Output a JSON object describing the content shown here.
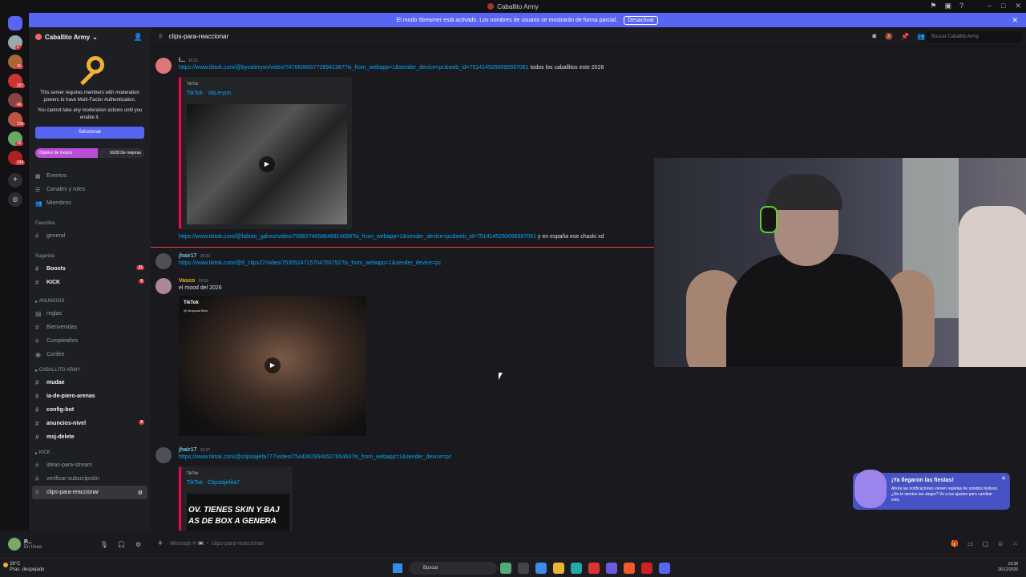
{
  "window": {
    "title": "Caballito Army"
  },
  "banner": {
    "text": "El modo Streamer está activado. Los nombres de usuario se mostrarán de forma parcial.",
    "button": "Desactivar"
  },
  "rail": {
    "badges": [
      "1",
      "90",
      "367",
      "46",
      "206",
      "10",
      "246"
    ]
  },
  "sidebar": {
    "server_name": "Caballito Army",
    "mfa_text": "This server requires members with moderation powers to have Multi-Factor Authentication.",
    "mfa_note": "You cannot take any moderation actions until you enable it.",
    "mfa_button": "Solucionar",
    "boost": {
      "label": "Objetivo de mejora",
      "count": "16/28 De mejoras",
      "progress": 0.57
    },
    "menu": [
      "Eventos",
      "Canales y roles",
      "Miembros"
    ],
    "favorites_label": "Favoritos",
    "favorite_channel": "general",
    "suggested_label": "Sugerido",
    "suggested": [
      {
        "name": "Boosts",
        "badge": "31"
      },
      {
        "name": "KICK",
        "badge": "5"
      }
    ],
    "cat_anuncios": "ANUNCIOS",
    "anuncios": [
      "reglas",
      "Bienvenidas",
      "Cumpleaños",
      "Confee"
    ],
    "cat_caballito": "CABALLITO ARMY",
    "caballito": [
      "mudae",
      "ia-de-piero-arenas",
      "config-bot",
      "anuncios-nivel",
      "msj-delete"
    ],
    "anuncios_nivel_badge": "9",
    "cat_kick": "KICK",
    "kick": [
      "ideas-para-stream",
      "verificar-subscripción",
      "clips-para-reaccionar"
    ]
  },
  "user": {
    "name": "P...",
    "status": "En línea"
  },
  "header": {
    "channel": "clips-para-reaccionar",
    "search_placeholder": "Buscar Caballito Army"
  },
  "messages": [
    {
      "author": "l...",
      "time": "19:21",
      "link1": "https://www.tiktok.com/@byvaleryon/video/7476606657728941367?is_from_webapp=1&sender_device=pc&web_id=7514145250095597061",
      "text1": "todos los caballitos este 2026",
      "embed_provider": "TikTok",
      "embed_title": "TikTok · VaLeryon",
      "link2": "https://www.tiktok.com/@fabian_galvez/video/7588274058848914699?is_from_webapp=1&sender_device=pc&web_id=7514145250095597061",
      "text2": "y en españa ese chaski xd"
    },
    {
      "author": "jhair17",
      "time": "19:33",
      "link": "https://www.tiktok.com/@tf_clips27/video/7535524715704765752?is_from_webapp=1&sender_device=pc"
    },
    {
      "author": "Vasco",
      "time": "19:33",
      "text": "el mood del 2026",
      "tiktok_label": "TikTok",
      "tiktok_handle": "@ farquaad.films"
    },
    {
      "author": "jhair17",
      "time": "19:37",
      "link": "https://www.tiktok.com/@clipslajefa777/video/7544062954652765463?is_from_webapp=1&sender_device=pc",
      "embed_provider": "TikTok",
      "embed_title": "TikTok · Clipslajefita7",
      "thumb_text": "OV. TIENES SKIN Y BAJ AS DE BOX A GENERA"
    }
  ],
  "input": {
    "placeholder": "Mensaje # 📼・ clips-para-reaccionar"
  },
  "toast": {
    "title": "¡Ya llegaron las fiestas!",
    "text": "Ahora las notificaciones vienen repletas de sonidos festivos. ¿No te sientes tan alegre? Ve a tus ajustes para cambiar esto."
  },
  "taskbar": {
    "temp": "28°C",
    "weather": "Prac. despejado",
    "search": "Buscar",
    "time": "19:38",
    "date": "26/12/2025"
  },
  "colors": {
    "accent": "#5865f2",
    "link": "#00a8fc",
    "bg": "#1a1a1e"
  }
}
